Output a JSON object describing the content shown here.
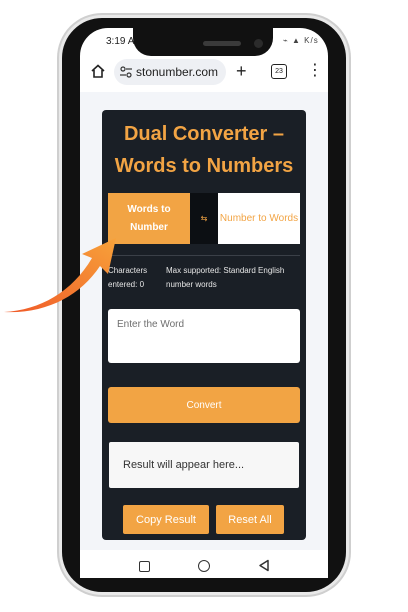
{
  "status": {
    "time": "3:19 AM",
    "indicators": "⌁ ▲ K/s"
  },
  "browser": {
    "url": "stonumber.com",
    "tab_count": "23",
    "icons": [
      "home-icon",
      "site-settings-icon",
      "plus-icon",
      "tabs-icon",
      "menu-icon"
    ]
  },
  "app": {
    "title": "Dual Converter – Words to Numbers",
    "tab_active": "Words to Number",
    "tab_inactive": "Number to Words",
    "swap_symbol": "⇆",
    "chars_label": "Characters entered: 0",
    "max_label": "Max supported: Standard English number words",
    "input_placeholder": "Enter the Word",
    "convert_label": "Convert",
    "result_placeholder": "Result will appear here...",
    "copy_label": "Copy Result",
    "reset_label": "Reset All"
  },
  "colors": {
    "accent": "#f2a444",
    "card": "#1a1f26",
    "arrow": "#f28a2e"
  }
}
